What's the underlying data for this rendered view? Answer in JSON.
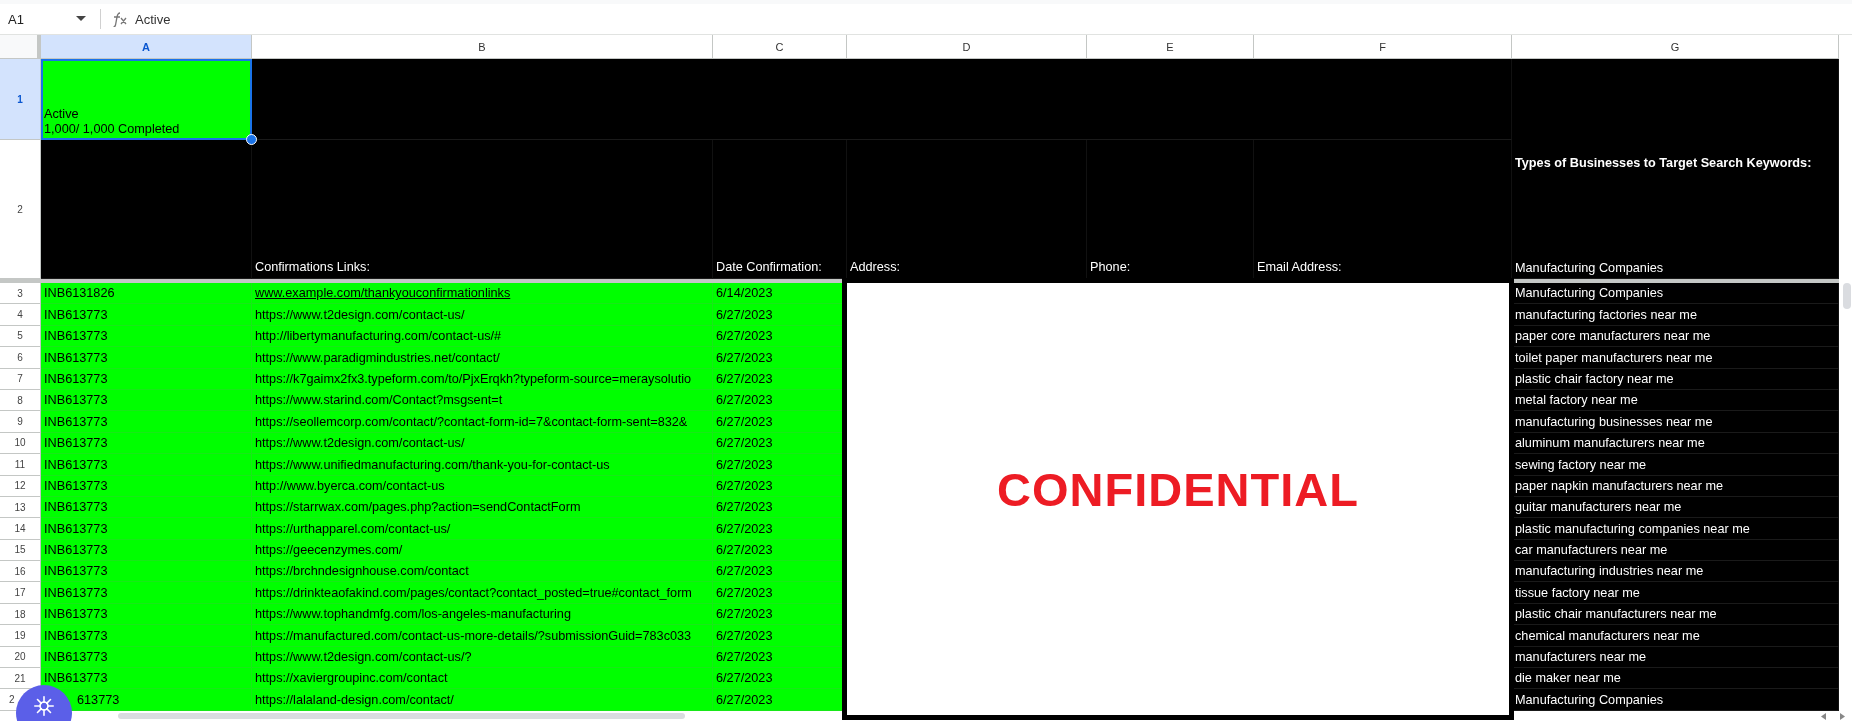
{
  "formula_bar": {
    "cell_ref": "A1",
    "formula": "Active"
  },
  "columns": [
    {
      "label": "A",
      "selected": true
    },
    {
      "label": "B",
      "selected": false
    },
    {
      "label": "C",
      "selected": false
    },
    {
      "label": "D",
      "selected": false
    },
    {
      "label": "E",
      "selected": false
    },
    {
      "label": "F",
      "selected": false
    },
    {
      "label": "G",
      "selected": false
    }
  ],
  "row_1": {
    "number": "1",
    "selected": true,
    "cell_a": "Active\n1,000/ 1,000 Completed",
    "cell_a_selected": true
  },
  "row_2": {
    "number": "2",
    "selected": false,
    "headers": [
      "Confirmations  Links:",
      "Date Confirmation:",
      "Address:",
      "Phone:",
      "Email Address:"
    ]
  },
  "keywords_title": "Types of Businesses to Target Search Keywords:",
  "keywords_header": "Manufacturing Companies",
  "rows": [
    {
      "number": "3",
      "selected": false,
      "id": "INB6131826",
      "link": "www.example.com/thankyouconfirmationlinks",
      "underlined": true,
      "date": "6/14/2023",
      "keyword": "Manufacturing Companies"
    },
    {
      "number": "4",
      "selected": false,
      "id": "INB613773",
      "link": "https://www.t2design.com/contact-us/",
      "underlined": false,
      "date": "6/27/2023",
      "keyword": "manufacturing factories near me"
    },
    {
      "number": "5",
      "selected": false,
      "id": "INB613773",
      "link": "http://libertymanufacturing.com/contact-us/#",
      "underlined": false,
      "date": "6/27/2023",
      "keyword": "paper core manufacturers near me"
    },
    {
      "number": "6",
      "selected": false,
      "id": "INB613773",
      "link": "https://www.paradigmindustries.net/contact/",
      "underlined": false,
      "date": "6/27/2023",
      "keyword": "toilet paper manufacturers near me"
    },
    {
      "number": "7",
      "selected": false,
      "id": "INB613773",
      "link": "https://k7gaimx2fx3.typeform.com/to/PjxErqkh?typeform-source=meraysolutio",
      "underlined": false,
      "date": "6/27/2023",
      "keyword": "plastic chair factory near me"
    },
    {
      "number": "8",
      "selected": false,
      "id": "INB613773",
      "link": "https://www.starind.com/Contact?msgsent=t",
      "underlined": false,
      "date": "6/27/2023",
      "keyword": "metal factory near me"
    },
    {
      "number": "9",
      "selected": false,
      "id": "INB613773",
      "link": "https://seollemcorp.com/contact/?contact-form-id=7&contact-form-sent=832&",
      "underlined": false,
      "date": "6/27/2023",
      "keyword": "manufacturing businesses near me"
    },
    {
      "number": "10",
      "selected": false,
      "id": "INB613773",
      "link": "https://www.t2design.com/contact-us/",
      "underlined": false,
      "date": "6/27/2023",
      "keyword": "aluminum manufacturers near me"
    },
    {
      "number": "11",
      "selected": false,
      "id": "INB613773",
      "link": "https://www.unifiedmanufacturing.com/thank-you-for-contact-us",
      "underlined": false,
      "date": "6/27/2023",
      "keyword": "sewing factory near me"
    },
    {
      "number": "12",
      "selected": false,
      "id": "INB613773",
      "link": "http://www.byerca.com/contact-us",
      "underlined": false,
      "date": "6/27/2023",
      "keyword": "paper napkin manufacturers near me"
    },
    {
      "number": "13",
      "selected": false,
      "id": "INB613773",
      "link": "https://starrwax.com/pages.php?action=sendContactForm",
      "underlined": false,
      "date": "6/27/2023",
      "keyword": "guitar manufacturers near me"
    },
    {
      "number": "14",
      "selected": false,
      "id": "INB613773",
      "link": "https://urthapparel.com/contact-us/",
      "underlined": false,
      "date": "6/27/2023",
      "keyword": "plastic manufacturing companies near me"
    },
    {
      "number": "15",
      "selected": false,
      "id": "INB613773",
      "link": "https://geecenzymes.com/",
      "underlined": false,
      "date": "6/27/2023",
      "keyword": "car manufacturers near me"
    },
    {
      "number": "16",
      "selected": false,
      "id": "INB613773",
      "link": "https://brchndesignhouse.com/contact",
      "underlined": false,
      "date": "6/27/2023",
      "keyword": "manufacturing industries near me"
    },
    {
      "number": "17",
      "selected": false,
      "id": "INB613773",
      "link": "https://drinkteaofakind.com/pages/contact?contact_posted=true#contact_form",
      "underlined": false,
      "date": "6/27/2023",
      "keyword": "tissue factory near me"
    },
    {
      "number": "18",
      "selected": false,
      "id": "INB613773",
      "link": "https://www.tophandmfg.com/los-angeles-manufacturing",
      "underlined": false,
      "date": "6/27/2023",
      "keyword": "plastic chair manufacturers near me"
    },
    {
      "number": "19",
      "selected": false,
      "id": "INB613773",
      "link": "https://manufactured.com/contact-us-more-details/?submissionGuid=783c033",
      "underlined": false,
      "date": "6/27/2023",
      "keyword": "chemical manufacturers near me"
    },
    {
      "number": "20",
      "selected": false,
      "id": "INB613773",
      "link": "https://www.t2design.com/contact-us/?",
      "underlined": false,
      "date": "6/27/2023",
      "keyword": "manufacturers near me"
    },
    {
      "number": "21",
      "selected": false,
      "id": "INB613773",
      "link": "https://xaviergroupinc.com/contact",
      "underlined": false,
      "date": "6/27/2023",
      "keyword": "die maker near me"
    },
    {
      "number": "2",
      "selected": false,
      "id": "613773",
      "link": "https://lalaland-design.com/contact/",
      "underlined": false,
      "date": "6/27/2023",
      "keyword": "Manufacturing Companies"
    }
  ],
  "overlay": {
    "text": "CONFIDENTIAL"
  }
}
